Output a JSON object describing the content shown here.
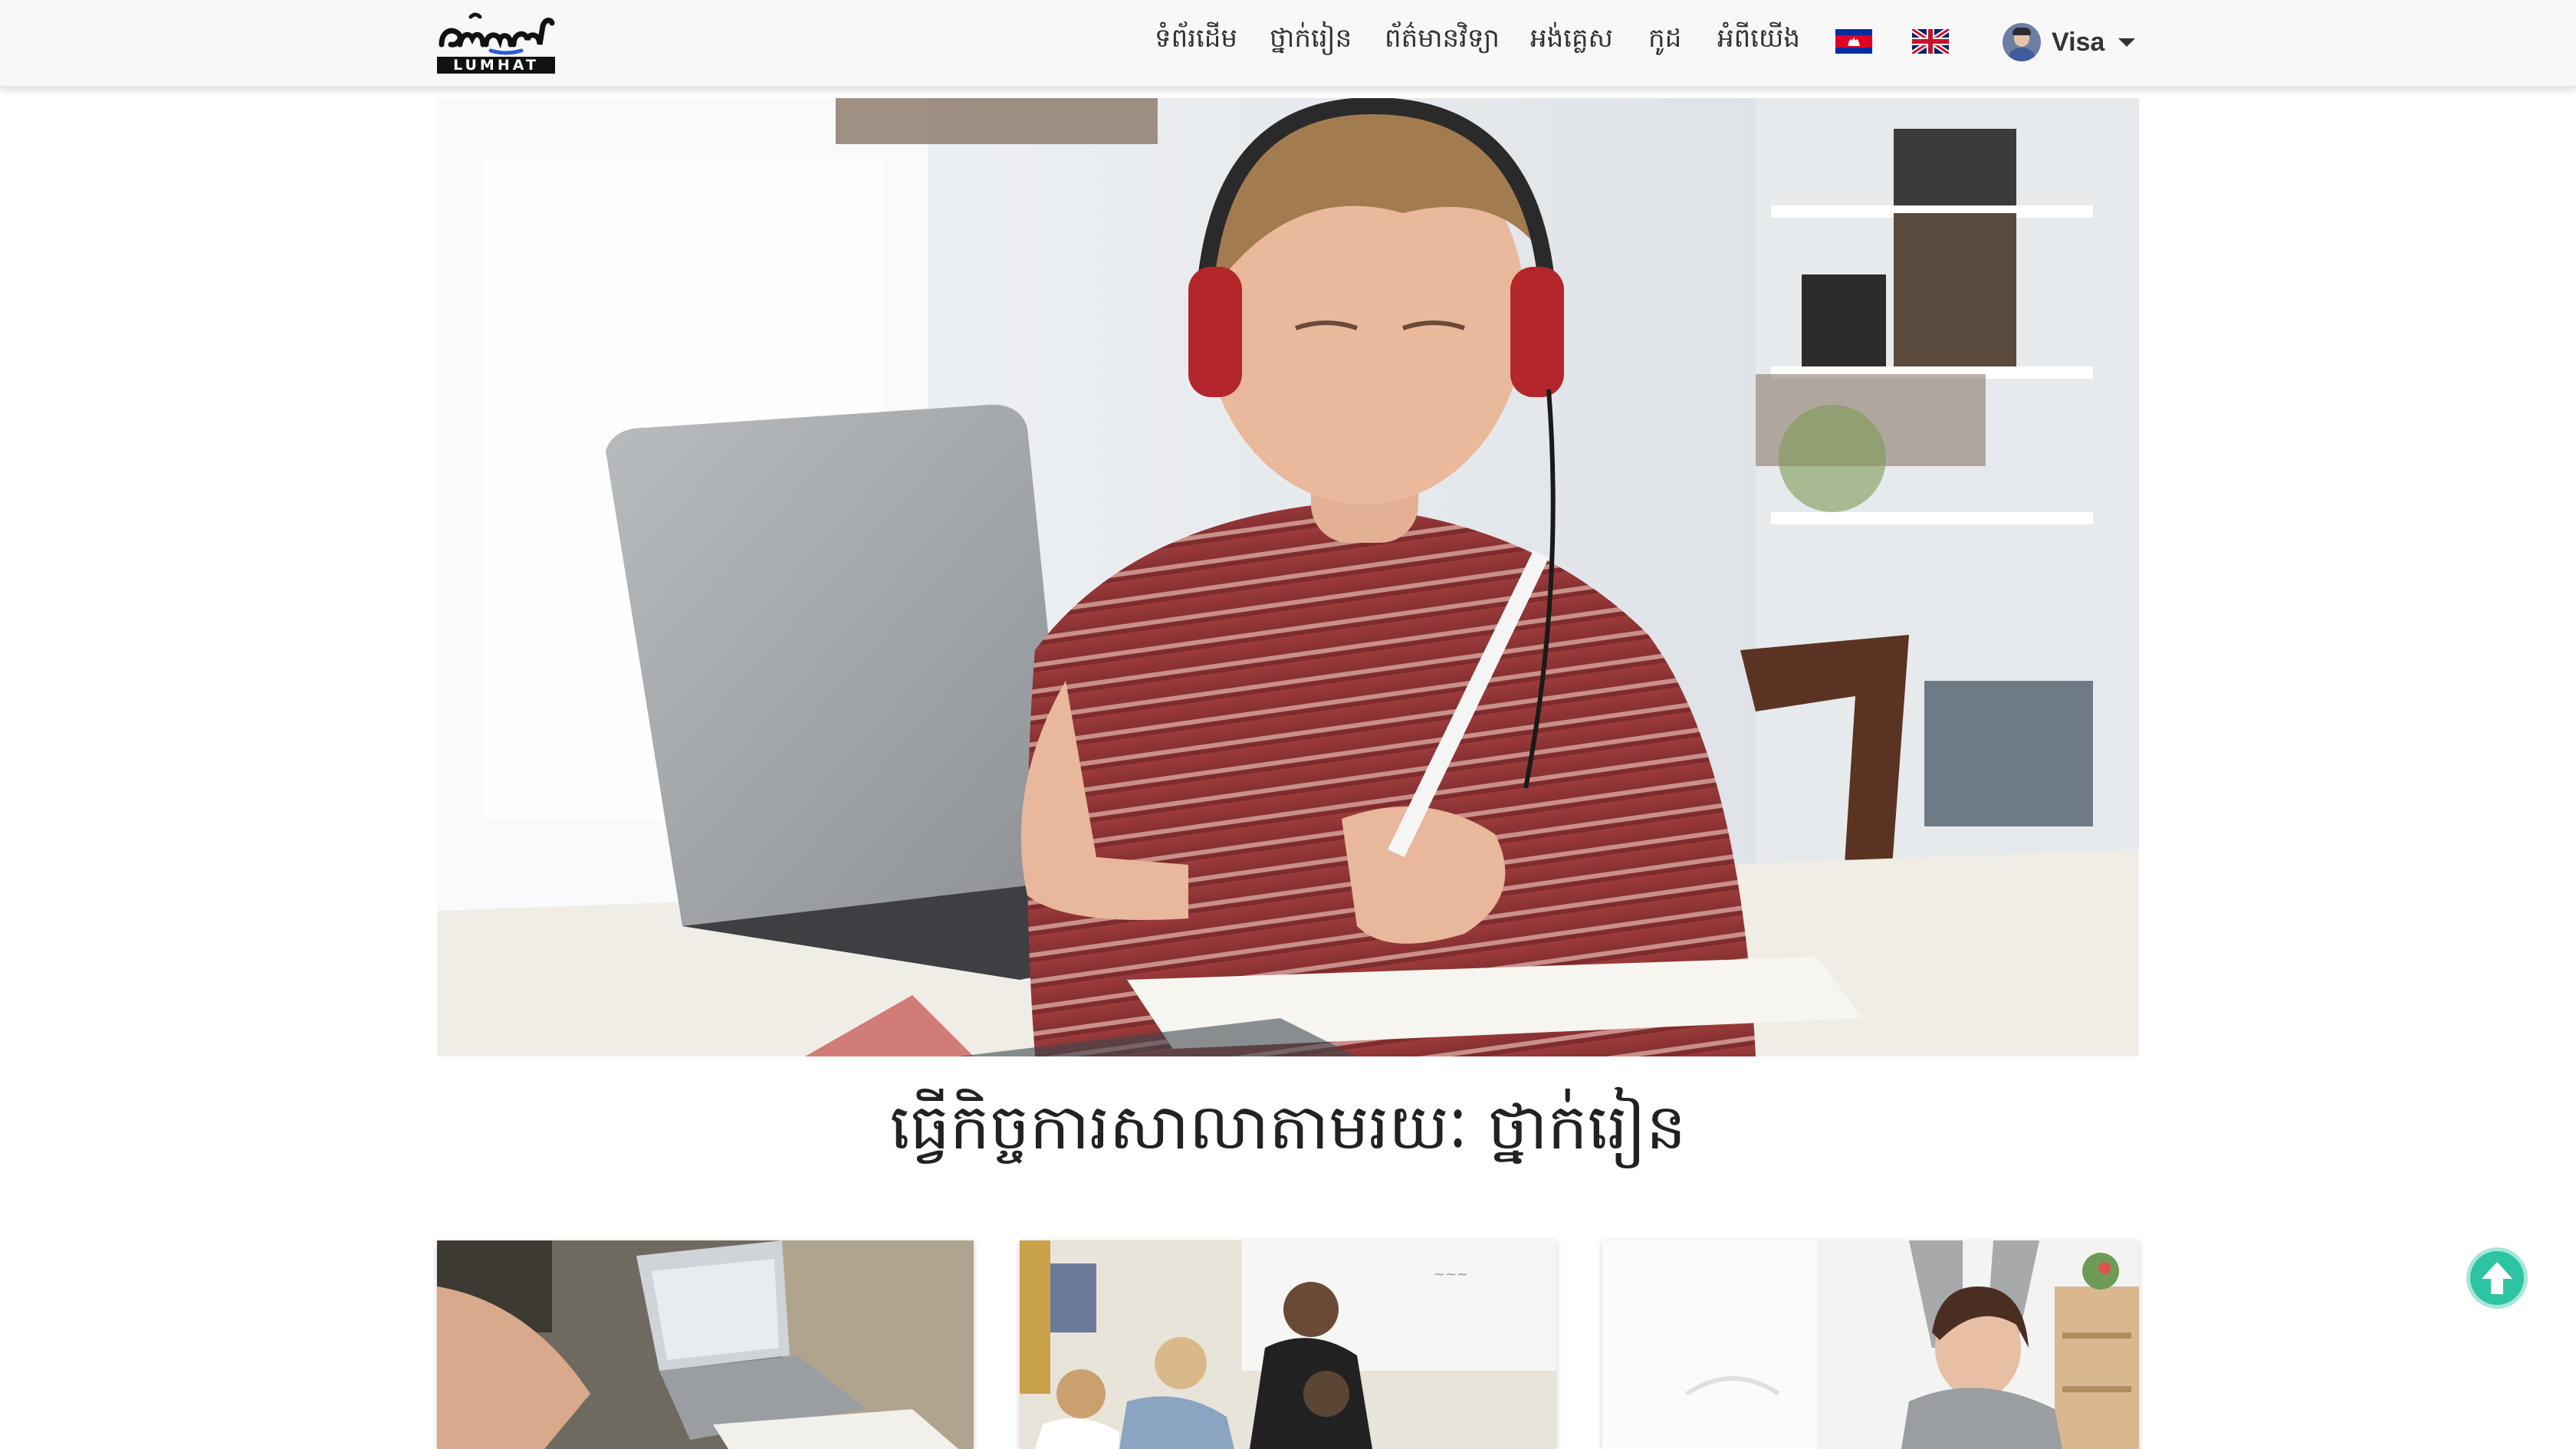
{
  "brand": {
    "name": "LUMHAT",
    "logo_text": "លំហាត់"
  },
  "nav": {
    "items": [
      {
        "label": "ទំព័រដើម"
      },
      {
        "label": "ថ្នាក់រៀន"
      },
      {
        "label": "ព័ត៌មានវិទ្យា"
      },
      {
        "label": "អង់គ្លេស"
      },
      {
        "label": "កូដ"
      },
      {
        "label": "អំពីយើង"
      }
    ],
    "languages": [
      {
        "icon": "cambodia-flag-icon"
      },
      {
        "icon": "uk-flag-icon"
      }
    ],
    "user": {
      "name": "Visa",
      "avatar_icon": "user-avatar-icon",
      "dropdown_icon": "caret-down-icon"
    }
  },
  "hero": {
    "image": "student-with-headphones-laptop-photo"
  },
  "page_title": "ធ្វើកិច្ចការសាលាតាមរយៈ ថ្នាក់រៀន",
  "cards": [
    {
      "image": "laptop-study-photo"
    },
    {
      "image": "classroom-teacher-photo"
    },
    {
      "image": "celebrating-woman-photo"
    }
  ],
  "scroll_top": {
    "icon": "arrow-up-circle-icon"
  },
  "colors": {
    "navbar_bg": "#f8f8f8",
    "scroll_button": "#2ec4a3"
  }
}
